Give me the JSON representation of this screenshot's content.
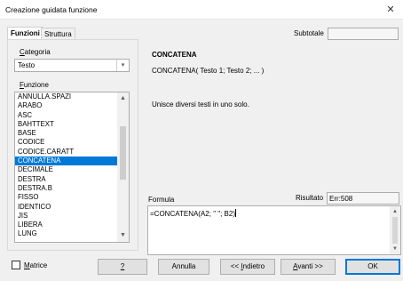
{
  "window": {
    "title": "Creazione guidata funzione",
    "close_glyph": "✕"
  },
  "tabs": [
    {
      "label": "Funzioni",
      "active": true
    },
    {
      "label": "Struttura",
      "active": false
    }
  ],
  "category": {
    "label_first": "C",
    "label_rest": "ategoria",
    "value": "Testo"
  },
  "function_list": {
    "label_first": "F",
    "label_rest": "unzione",
    "items": [
      "ANNULLA.SPAZI",
      "ARABO",
      "ASC",
      "BAHTTEXT",
      "BASE",
      "CODICE",
      "CODICE.CARATT",
      "CONCATENA",
      "DECIMALE",
      "DESTRA",
      "DESTRA.B",
      "FISSO",
      "IDENTICO",
      "JIS",
      "LIBERA",
      "LUNG"
    ],
    "selected": "CONCATENA"
  },
  "subtotal": {
    "label": "Subtotale",
    "value": ""
  },
  "function_info": {
    "name": "CONCATENA",
    "signature": "CONCATENA( Testo 1; Testo 2; ... )",
    "description": "Unisce diversi testi in uno solo."
  },
  "formula": {
    "label": "Formula",
    "value": "=CONCATENA(A2; \" \"; B2)"
  },
  "result": {
    "label": "Risultato",
    "value": "Err:508"
  },
  "matrix": {
    "label_first": "M",
    "label_rest": "atrice",
    "checked": false
  },
  "buttons": {
    "help": "?",
    "cancel": "Annulla",
    "back_prefix": "<< ",
    "back_first": "I",
    "back_rest": "ndietro",
    "next_first": "A",
    "next_rest": "vanti >>",
    "ok": "OK"
  },
  "colors": {
    "selection": "#0078d7",
    "dialog_bg": "#f0f0f0"
  }
}
